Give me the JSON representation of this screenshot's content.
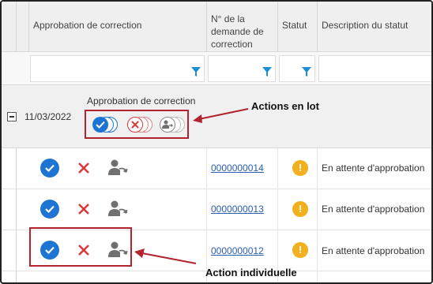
{
  "header": {
    "col_approbation": "Approbation de correction",
    "col_numero": "N° de la demande de correction",
    "col_statut": "Statut",
    "col_description": "Description du statut"
  },
  "group": {
    "date": "11/03/2022",
    "title": "Approbation de correction"
  },
  "rows": [
    {
      "number": "0000000014",
      "status_text": "En attente d'approbation",
      "status_icon": "!"
    },
    {
      "number": "0000000013",
      "status_text": "En attente d'approbation",
      "status_icon": "!"
    },
    {
      "number": "0000000012",
      "status_text": "En attente d'approbation",
      "status_icon": "!"
    }
  ],
  "annotations": {
    "bulk": "Actions en lot",
    "individual": "Action individuelle"
  },
  "colors": {
    "approve": "#1e74d3",
    "reject": "#d83b3b",
    "reassign": "#707070",
    "warning": "#f2b01e",
    "callout": "#b3232e",
    "link": "#2a5db0"
  },
  "icons": [
    "approve-check-icon",
    "reject-x-icon",
    "reassign-user-icon",
    "warning-icon",
    "filter-funnel-icon",
    "collapse-minus-icon",
    "arrow-icon"
  ]
}
